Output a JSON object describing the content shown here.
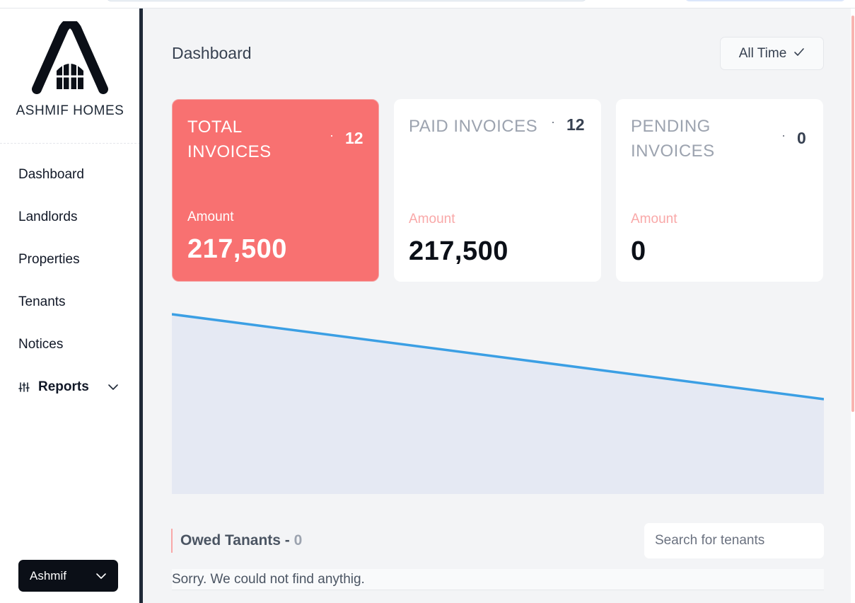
{
  "brand": {
    "name": "ASHMIF HOMES"
  },
  "sidebar": {
    "items": [
      {
        "label": "Dashboard"
      },
      {
        "label": "Landlords"
      },
      {
        "label": "Properties"
      },
      {
        "label": "Tenants"
      },
      {
        "label": "Notices"
      },
      {
        "label": "Reports",
        "icon": "sliders-icon",
        "expandable": true
      }
    ],
    "user": {
      "name": "Ashmif"
    }
  },
  "header": {
    "title": "Dashboard",
    "time_filter": {
      "label": "All Time",
      "icon": "check-icon"
    }
  },
  "cards": [
    {
      "title": "TOTAL INVOICES",
      "count": "12",
      "amount_label": "Amount",
      "amount": "217,500"
    },
    {
      "title": "PAID INVOICES",
      "count": "12",
      "amount_label": "Amount",
      "amount": "217,500"
    },
    {
      "title": "PENDING INVOICES",
      "count": "0",
      "amount_label": "Amount",
      "amount": "0"
    }
  ],
  "chart_data": {
    "type": "area",
    "series": [
      {
        "values": [
          217500,
          0
        ]
      }
    ],
    "colors": {
      "line": "#3b9fe4",
      "fill": "#e5e9f3"
    }
  },
  "owed": {
    "title": "Owed Tanants - ",
    "count": "0",
    "search_placeholder": "Search for tenants",
    "empty_message": "Sorry. We could not find anythig."
  },
  "colors": {
    "accent": "#f87171",
    "sidebar_divider": "#1f2937",
    "background": "#f3f4f6"
  }
}
